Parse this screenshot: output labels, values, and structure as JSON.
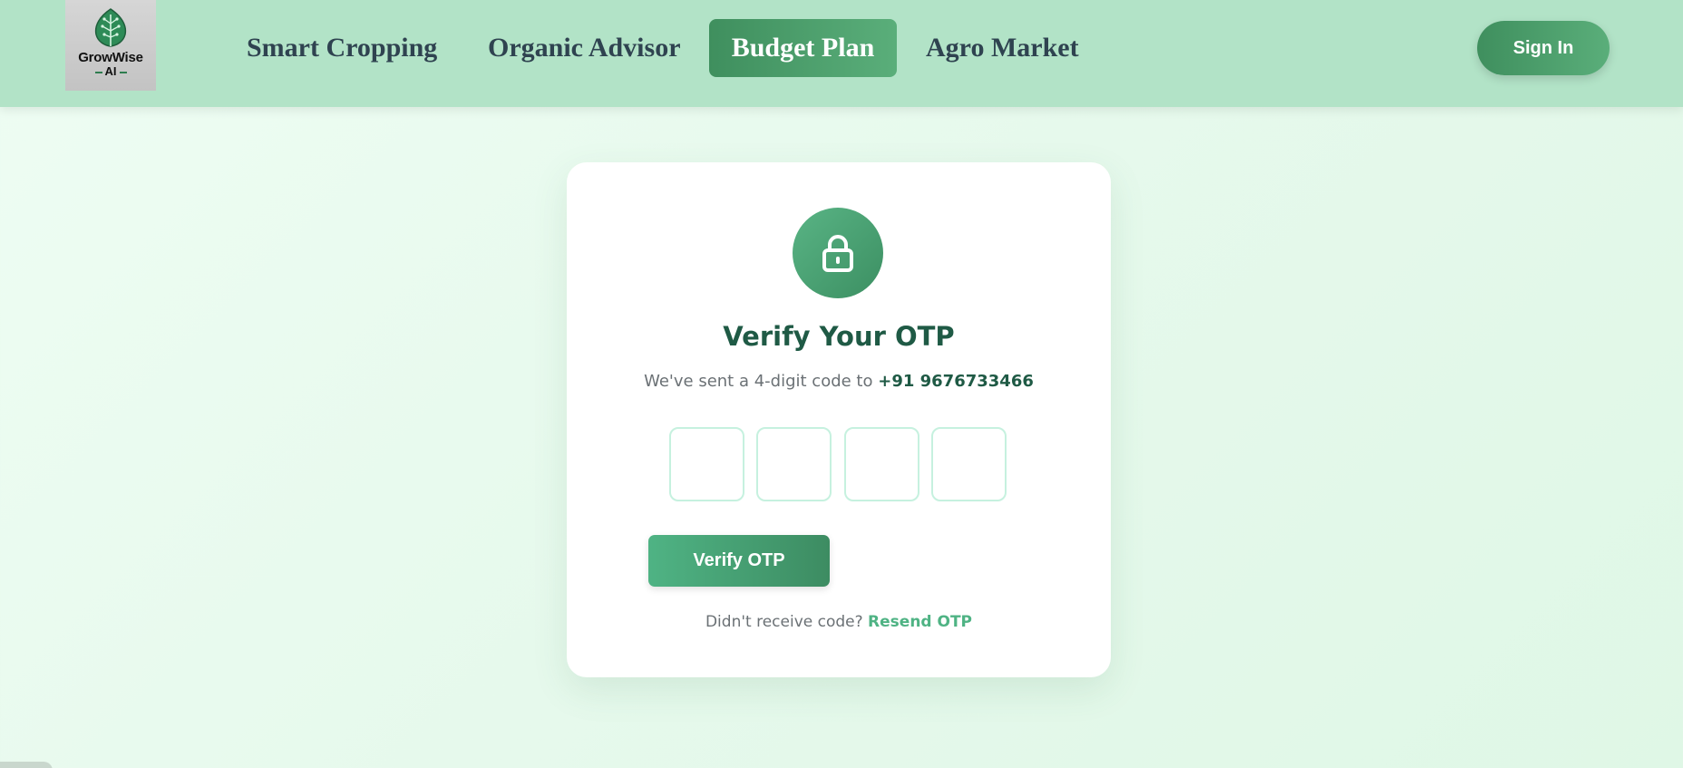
{
  "brand": {
    "logo_name": "GrowWise",
    "logo_sub": "AI"
  },
  "nav": {
    "items": [
      {
        "label": "Smart Cropping"
      },
      {
        "label": "Organic Advisor"
      },
      {
        "label": "Budget Plan",
        "active": true
      },
      {
        "label": "Agro Market"
      }
    ],
    "signin_label": "Sign In"
  },
  "card": {
    "icon": "lock-icon",
    "title": "Verify Your OTP",
    "subtitle_prefix": "We've sent a 4-digit code to",
    "phone": "+91 9676733466",
    "otp_digits": [
      "",
      "",
      "",
      ""
    ],
    "verify_label": "Verify OTP",
    "resend_prompt": "Didn't receive code?",
    "resend_link": "Resend OTP"
  },
  "colors": {
    "header_bg": "#b2e3c7",
    "accent": "#4fb384",
    "accent_dark": "#3d8c62",
    "title": "#1f5a45"
  }
}
